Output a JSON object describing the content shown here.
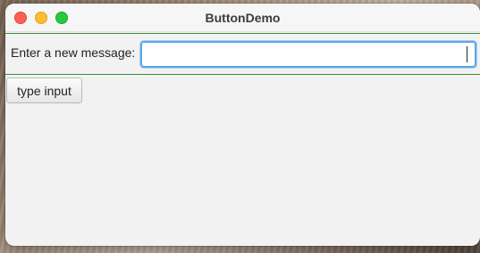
{
  "window": {
    "title": "ButtonDemo"
  },
  "form": {
    "label": "Enter a new message:",
    "input_value": "",
    "input_placeholder": ""
  },
  "actions": {
    "type_input_label": "type input"
  },
  "colors": {
    "close": "#fe5f57",
    "minimize": "#febc2e",
    "zoom": "#28c840",
    "focus_ring": "#5ba6e8",
    "separator": "#3c8a3c",
    "window_bg": "#f2f2f2"
  }
}
